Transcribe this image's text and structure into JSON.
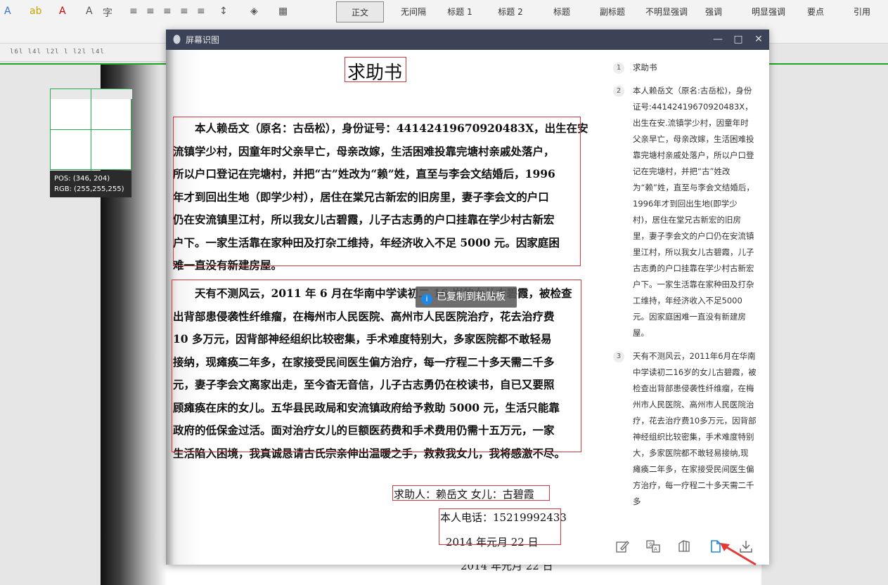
{
  "ribbon": {
    "styles": [
      "正文",
      "无间隔",
      "标题 1",
      "标题 2",
      "标题",
      "副标题",
      "不明显强调",
      "强调",
      "明显强调",
      "要点",
      "引用"
    ],
    "ruler": "l6l l4l l2l l l2l l4l"
  },
  "magnifier": {
    "pos_label": "POS:",
    "pos_value": "(346, 204)",
    "rgb_label": "RGB:",
    "rgb_value": "(255,255,255)"
  },
  "dialog": {
    "title": "屏幕识图",
    "toast": "已复制到粘贴板",
    "scan": {
      "heading": "求助书",
      "para1": [
        "　　本人赖岳文（原名：古岳松），身份证号：441424196709204​83X，出生在安",
        "流镇学少村，因童年时父亲早亡，母亲改嫁，生活困难投靠完塘村亲戚处落户，",
        "所以户口登记在完塘村，并把“古”姓改为“赖”姓，直至与李会文结婚后，1996",
        "年才到回出生地（即学少村），居住在棠兄古新宏的旧房里，妻子李会文的户口",
        "仍在安流镇里江村，所以我女儿古碧霞，儿子古志勇的户口挂靠在学少村古新宏",
        "户下。一家生活靠在家种田及打杂工维持，年经济收入不足 5000 元。因家庭困",
        "难一直没有新建房屋。"
      ],
      "para2": [
        "　　天有不测风云，2011 年 6 月在华南中学读初二 16 岁的女儿古碧霞，被检查",
        "出背部患侵袭性纤维瘤，在梅州市人民医院、高州市人民医院治疗，花去治疗费",
        "10 多万元，因背部神经组织比较密集，手术难度特别大，多家医院都不敢轻易",
        "接纳，现瘫痪二年多，在家接受民间医生偏方治疗，每一疗程二十多天需二千多",
        "元，妻子李会文离家出走，至今杳无音信，儿子古志勇仍在校读书，自已又要照",
        "顾瘫痪在床的女儿。五华县民政局和安流镇政府给予救助 5000 元，生活只能靠",
        "政府的低保金过活。面对治疗女儿的巨额医药费和手术费用仍需十五万元，一家",
        "生活陷入困境，我真诚恳请古氏宗亲伸出温暖之手，救救我女儿，我将感激不尽。"
      ],
      "sign": "求助人：赖岳文  女儿：古碧霞",
      "phone": "本人电话：15219992433",
      "date": "2014 年元月 22 日"
    },
    "results": [
      {
        "num": "1",
        "text": "求助书"
      },
      {
        "num": "2",
        "text": "本人赖岳文（原名:古岳松)，身份证号:44142419670920483X，出生在安.流镇学少村，因童年时父亲早亡，母亲改嫁，生活困难投靠完塘村亲戚处落户，所以户口登记在完塘村，并把“古”姓改为“赖”姓，直至与李会文结婚后，1996年才到回出生地(即学少村)，居住在堂兄古新宏的旧房里，妻子李会文的户口仍在安流镇里江村，所以我女儿古碧霞，儿子古志勇的户口挂靠在学少村古新宏户下。一家生活靠在家种田及打杂工维持，年经济收入不足5000元。因家庭困难一直没有新建房屋。"
      },
      {
        "num": "3",
        "text": "天有不测风云，2011年6月在华南中学读初二16岁的女儿古碧霞，被检查出背部患侵袭性纤维瘤，在梅州市人民医院、高州市人民医院治疗，花去治疗费10多万元，因背部神经组织比较密集，手术难度特别大，多家医院都不敢轻易接纳,现瘫痪二年多，在家接受民间医生偏方治疗，每一疗程二十多天需二千多"
      }
    ]
  },
  "background": {
    "footer_date": "2014 年元月 22 日"
  },
  "colors": {
    "titlebar": "#3c4356",
    "ocr_box": "#d9363e",
    "active_tool": "#1e88e5",
    "green_line": "#1fa51f"
  }
}
